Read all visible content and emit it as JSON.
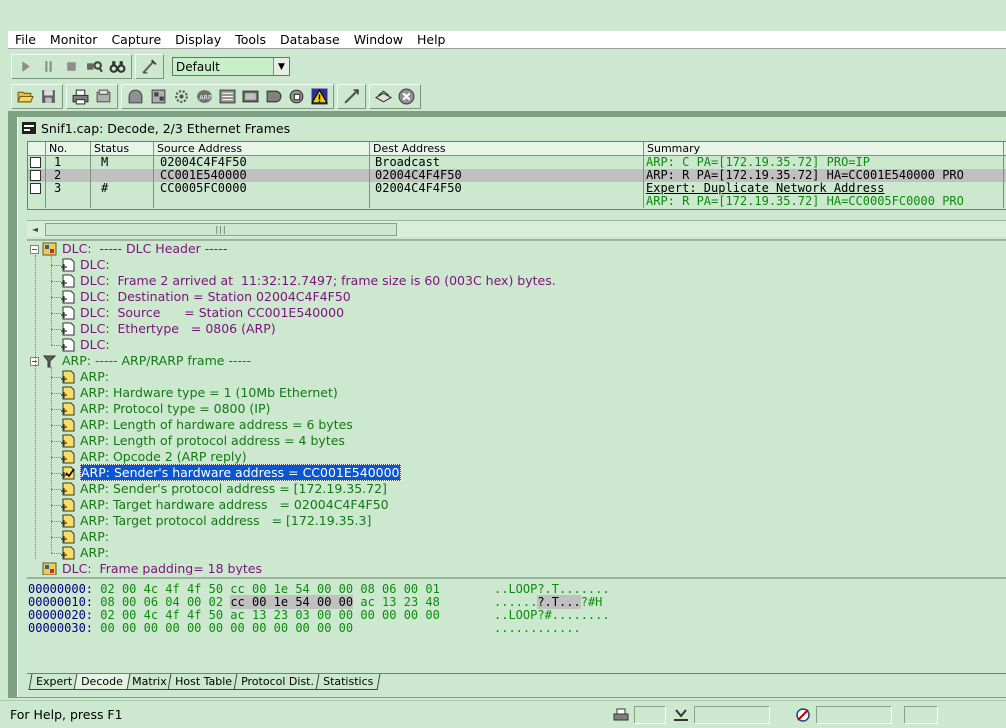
{
  "menu": [
    "File",
    "Monitor",
    "Capture",
    "Display",
    "Tools",
    "Database",
    "Window",
    "Help"
  ],
  "toolbar": {
    "profile_select_value": "Default"
  },
  "icons": {
    "play": "play-icon",
    "pause": "pause-icon",
    "stop": "stop-icon",
    "stop-view": "stop-and-view-icon",
    "view": "binoculars-icon",
    "clear": "clear-buffer-icon",
    "open": "open-folder-icon",
    "save": "save-icon",
    "print": "print-icon",
    "capture-filter": "capture-filter-icon"
  },
  "window": {
    "title": "Snif1.cap: Decode, 2/3 Ethernet Frames"
  },
  "frames": {
    "columns": [
      "No.",
      "Status",
      "Source Address",
      "Dest Address",
      "Summary"
    ],
    "rows": [
      {
        "no": "1",
        "status": "M",
        "src": "02004C4F4F50",
        "dst": "Broadcast",
        "summary": [
          "ARP: C PA=[172.19.35.72] PRO=IP"
        ]
      },
      {
        "no": "2",
        "status": "",
        "src": "CC001E540000",
        "dst": "02004C4F4F50",
        "summary": [
          "ARP: R PA=[172.19.35.72] HA=CC001E540000 PRO"
        ]
      },
      {
        "no": "3",
        "status": "#",
        "src": "CC0005FC0000",
        "dst": "02004C4F4F50",
        "summary": [
          "Expert: Duplicate Network Address",
          "ARP: R PA=[172.19.35.72] HA=CC0005FC0000 PRO"
        ]
      }
    ]
  },
  "decode": {
    "dlc_header": "DLC:  ----- DLC Header -----",
    "dlc_lines": [
      "DLC:",
      "DLC:  Frame 2 arrived at  11:32:12.7497; frame size is 60 (003C hex) bytes.",
      "DLC:  Destination = Station 02004C4F4F50",
      "DLC:  Source      = Station CC001E540000",
      "DLC:  Ethertype   = 0806 (ARP)",
      "DLC:"
    ],
    "arp_header": "ARP: ----- ARP/RARP frame -----",
    "arp_lines": [
      "ARP:",
      "ARP: Hardware type = 1 (10Mb Ethernet)",
      "ARP: Protocol type = 0800 (IP)",
      "ARP: Length of hardware address = 6 bytes",
      "ARP: Length of protocol address = 4 bytes",
      "ARP: Opcode 2 (ARP reply)",
      "ARP: Sender's hardware address = CC001E540000",
      "ARP: Sender's protocol address = [172.19.35.72]",
      "ARP: Target hardware address   = 02004C4F4F50",
      "ARP: Target protocol address   = [172.19.35.3]",
      "ARP:",
      "ARP:"
    ],
    "padding_line": "DLC:  Frame padding= 18 bytes"
  },
  "hex": {
    "lines": [
      {
        "off": "00000000:",
        "pre": "02 00 4c 4f 4f 50 cc 00 1e 54 00 00 08 06 00 01",
        "hl": "",
        "post": "",
        "ascii_pre": "..LOOP?.T.......",
        "ascii_hl": "",
        "ascii_post": ""
      },
      {
        "off": "00000010:",
        "pre": "08 00 06 04 00 02 ",
        "hl": "cc 00 1e 54 00 00",
        "post": " ac 13 23 48",
        "ascii_pre": "......",
        "ascii_hl": "?.T...",
        "ascii_post": "?#H"
      },
      {
        "off": "00000020:",
        "pre": "02 00 4c 4f 4f 50 ac 13 23 03 00 00 00 00 00 00",
        "hl": "",
        "post": "",
        "ascii_pre": "..LOOP?#........",
        "ascii_hl": "",
        "ascii_post": ""
      },
      {
        "off": "00000030:",
        "pre": "00 00 00 00 00 00 00 00 00 00 00 00",
        "hl": "",
        "post": "",
        "ascii_pre": "............",
        "ascii_hl": "",
        "ascii_post": ""
      }
    ]
  },
  "tabs": [
    "Expert",
    "Decode",
    "Matrix",
    "Host Table",
    "Protocol Dist.",
    "Statistics"
  ],
  "status": {
    "text": "For Help, press F1"
  }
}
